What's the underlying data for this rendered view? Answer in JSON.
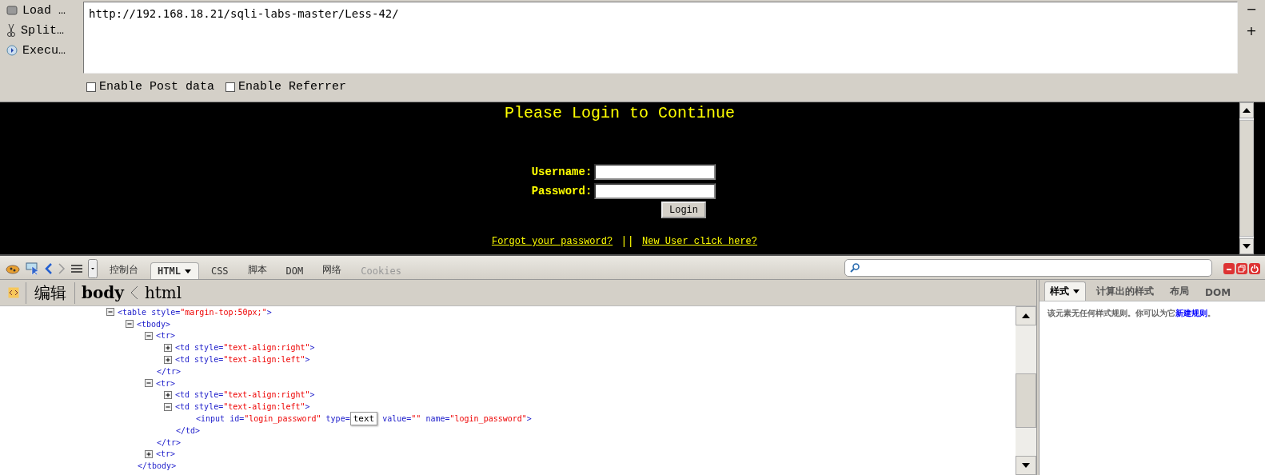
{
  "hackbar": {
    "menu": [
      {
        "kind": "load",
        "label": "Load …"
      },
      {
        "kind": "split",
        "label": "Split…"
      },
      {
        "kind": "execute",
        "label": "Execu…"
      }
    ],
    "url": "http://192.168.18.21/sqli-labs-master/Less-42/",
    "options": [
      {
        "label": "Enable Post data",
        "checked": false
      },
      {
        "label": "Enable Referrer",
        "checked": false
      }
    ],
    "side_buttons": [
      "−",
      "+"
    ]
  },
  "page": {
    "title": "Please Login to Continue",
    "fields": [
      {
        "label": "Username:"
      },
      {
        "label": "Password:"
      }
    ],
    "button": "Login",
    "links": [
      {
        "label": "Forgot your password?"
      },
      {
        "label": "New User click here?"
      }
    ],
    "separator": "||"
  },
  "devtools": {
    "tabs": [
      {
        "label": "控制台",
        "selected": false,
        "disabled": false
      },
      {
        "label": "HTML",
        "selected": true,
        "disabled": false
      },
      {
        "label": "CSS",
        "selected": false,
        "disabled": false
      },
      {
        "label": "脚本",
        "selected": false,
        "disabled": false
      },
      {
        "label": "DOM",
        "selected": false,
        "disabled": false
      },
      {
        "label": "网络",
        "selected": false,
        "disabled": false
      },
      {
        "label": "Cookies",
        "selected": false,
        "disabled": true
      }
    ],
    "breadcrumb": {
      "edit": "编辑",
      "path": [
        "body",
        "html"
      ]
    },
    "tree": [
      {
        "segments": [
          {
            "kind": "tag",
            "text": "<table style="
          },
          {
            "kind": "value",
            "text": "\"margin-top:50px;\""
          },
          {
            "kind": "tag",
            "text": ">"
          }
        ],
        "expanded": true,
        "children": [
          {
            "segments": [
              {
                "kind": "tag",
                "text": "<tbody>"
              }
            ],
            "expanded": true,
            "children": [
              {
                "segments": [
                  {
                    "kind": "tag",
                    "text": "<tr>"
                  }
                ],
                "expanded": true,
                "children": [
                  {
                    "segments": [
                      {
                        "kind": "tag",
                        "text": "<td style="
                      },
                      {
                        "kind": "value",
                        "text": "\"text-align:right\""
                      },
                      {
                        "kind": "tag",
                        "text": ">"
                      }
                    ],
                    "expanded": false
                  },
                  {
                    "segments": [
                      {
                        "kind": "tag",
                        "text": "<td style="
                      },
                      {
                        "kind": "value",
                        "text": "\"text-align:left\""
                      },
                      {
                        "kind": "tag",
                        "text": ">"
                      }
                    ],
                    "expanded": false
                  }
                ],
                "close": "</tr>"
              },
              {
                "segments": [
                  {
                    "kind": "tag",
                    "text": "<tr>"
                  }
                ],
                "expanded": true,
                "children": [
                  {
                    "segments": [
                      {
                        "kind": "tag",
                        "text": "<td style="
                      },
                      {
                        "kind": "value",
                        "text": "\"text-align:right\""
                      },
                      {
                        "kind": "tag",
                        "text": ">"
                      }
                    ],
                    "expanded": false
                  },
                  {
                    "segments": [
                      {
                        "kind": "tag",
                        "text": "<td style="
                      },
                      {
                        "kind": "value",
                        "text": "\"text-align:left\""
                      },
                      {
                        "kind": "tag",
                        "text": ">"
                      }
                    ],
                    "expanded": true,
                    "children": [
                      {
                        "segments": [
                          {
                            "kind": "tag",
                            "text": "<input id="
                          },
                          {
                            "kind": "value",
                            "text": "\"login_password\""
                          },
                          {
                            "kind": "tag",
                            "text": " type="
                          },
                          {
                            "kind": "tooltip",
                            "text": "text"
                          },
                          {
                            "kind": "tag",
                            "text": " value="
                          },
                          {
                            "kind": "value",
                            "text": "\"\""
                          },
                          {
                            "kind": "tag",
                            "text": " name="
                          },
                          {
                            "kind": "value",
                            "text": "\"login_password\""
                          },
                          {
                            "kind": "tag",
                            "text": ">"
                          }
                        ]
                      }
                    ],
                    "close": "</td>"
                  }
                ],
                "close": "</tr>"
              },
              {
                "segments": [
                  {
                    "kind": "tag",
                    "text": "<tr>"
                  }
                ],
                "expanded": false
              }
            ],
            "close": "</tbody>"
          }
        ]
      }
    ],
    "side_tabs": [
      {
        "label": "样式",
        "selected": true,
        "dropdown": true
      },
      {
        "label": "计算出的样式",
        "selected": false,
        "dropdown": false
      },
      {
        "label": "布局",
        "selected": false,
        "dropdown": false
      },
      {
        "label": "DOM",
        "selected": false,
        "dropdown": false
      }
    ],
    "style_message": {
      "text": "该元素无任何样式规则。你可以为它",
      "link": "新建规则",
      "end": "。"
    }
  }
}
